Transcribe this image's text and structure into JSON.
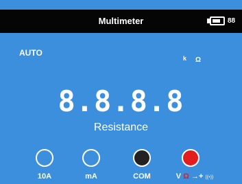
{
  "header": {
    "title": "Multimeter",
    "battery_level": 0.8,
    "battery_value": "88"
  },
  "display": {
    "mode": "AUTO",
    "unit_prefix": "k",
    "unit_symbol": "Ω",
    "reading": "8.8.8.8",
    "measurement": "Resistance"
  },
  "jacks": [
    {
      "label": "10A",
      "fill": "#3b8fdc"
    },
    {
      "label": "mA",
      "fill": "#3b8fdc"
    },
    {
      "label": "COM",
      "fill": "#222222"
    },
    {
      "label_v": "V",
      "label_ohm": "Ω",
      "label_diode": "→+",
      "label_buzz": "((•))",
      "fill": "#e11d1d"
    }
  ],
  "colors": {
    "background": "#3b8fdc",
    "title_bar": "#050505",
    "com": "#222222",
    "volt_ohm": "#e11d1d"
  }
}
